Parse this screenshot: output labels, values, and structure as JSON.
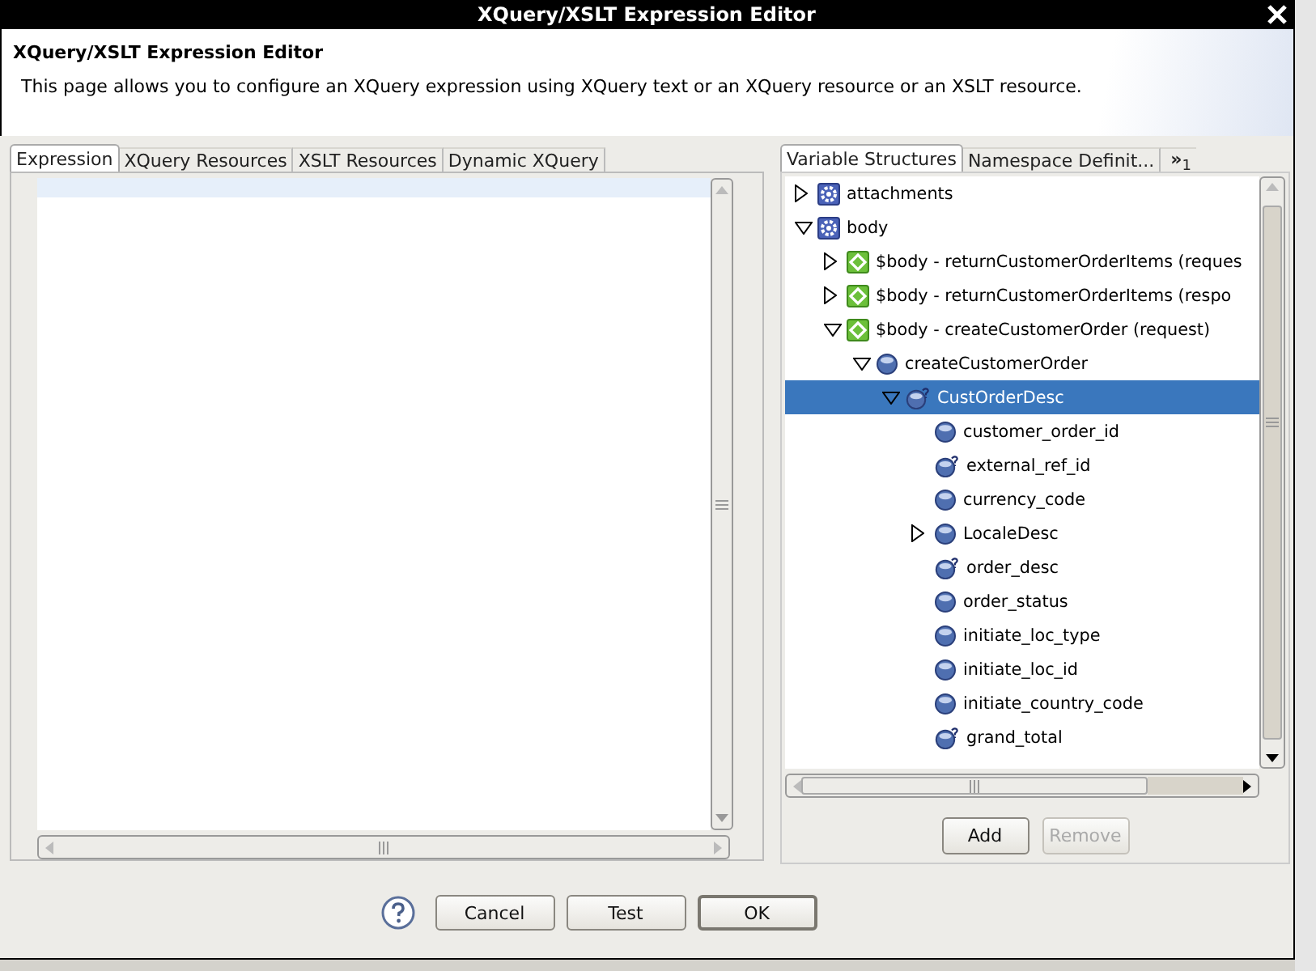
{
  "window": {
    "title": "XQuery/XSLT Expression Editor"
  },
  "header": {
    "title": "XQuery/XSLT Expression Editor",
    "description": "This page allows you to configure an XQuery expression using XQuery text or an XQuery resource or an XSLT resource."
  },
  "expression_tabs": [
    {
      "label": "Expression",
      "selected": true
    },
    {
      "label": "XQuery Resources",
      "selected": false
    },
    {
      "label": "XSLT Resources",
      "selected": false
    },
    {
      "label": "Dynamic XQuery",
      "selected": false
    }
  ],
  "variable_tabs": [
    {
      "label": "Variable Structures",
      "selected": true
    },
    {
      "label": "Namespace Definit...",
      "selected": false
    }
  ],
  "overflow_tab": {
    "label": "»",
    "count": "1"
  },
  "variable_tree": [
    {
      "label": "attachments",
      "kind": "service",
      "expanded": false,
      "selected": false
    },
    {
      "label": "body",
      "kind": "service",
      "expanded": true,
      "selected": false,
      "children": [
        {
          "label": "$body - returnCustomerOrderItems (reques",
          "kind": "message",
          "expanded": false,
          "selected": false
        },
        {
          "label": "$body - returnCustomerOrderItems (respo",
          "kind": "message",
          "expanded": false,
          "selected": false
        },
        {
          "label": "$body - createCustomerOrder (request)",
          "kind": "message",
          "expanded": true,
          "selected": false,
          "children": [
            {
              "label": "createCustomerOrder",
              "kind": "element",
              "expanded": true,
              "selected": false,
              "children": [
                {
                  "label": "CustOrderDesc",
                  "kind": "optional_element",
                  "expanded": true,
                  "selected": true,
                  "children": [
                    {
                      "label": "customer_order_id",
                      "kind": "element",
                      "selected": false
                    },
                    {
                      "label": "external_ref_id",
                      "kind": "optional_element",
                      "selected": false
                    },
                    {
                      "label": "currency_code",
                      "kind": "element",
                      "selected": false
                    },
                    {
                      "label": "LocaleDesc",
                      "kind": "element",
                      "expanded": false,
                      "selected": false
                    },
                    {
                      "label": "order_desc",
                      "kind": "optional_element",
                      "selected": false
                    },
                    {
                      "label": "order_status",
                      "kind": "element",
                      "selected": false
                    },
                    {
                      "label": "initiate_loc_type",
                      "kind": "element",
                      "selected": false
                    },
                    {
                      "label": "initiate_loc_id",
                      "kind": "element",
                      "selected": false
                    },
                    {
                      "label": "initiate_country_code",
                      "kind": "element",
                      "selected": false
                    },
                    {
                      "label": "grand_total",
                      "kind": "optional_element",
                      "selected": false
                    }
                  ]
                }
              ]
            }
          ]
        }
      ]
    }
  ],
  "tree_buttons": [
    {
      "label": "Add",
      "disabled": false
    },
    {
      "label": "Remove",
      "disabled": true
    }
  ],
  "dialog_buttons": [
    {
      "label": "Cancel",
      "default": false
    },
    {
      "label": "Test",
      "default": false
    },
    {
      "label": "OK",
      "default": true
    }
  ]
}
